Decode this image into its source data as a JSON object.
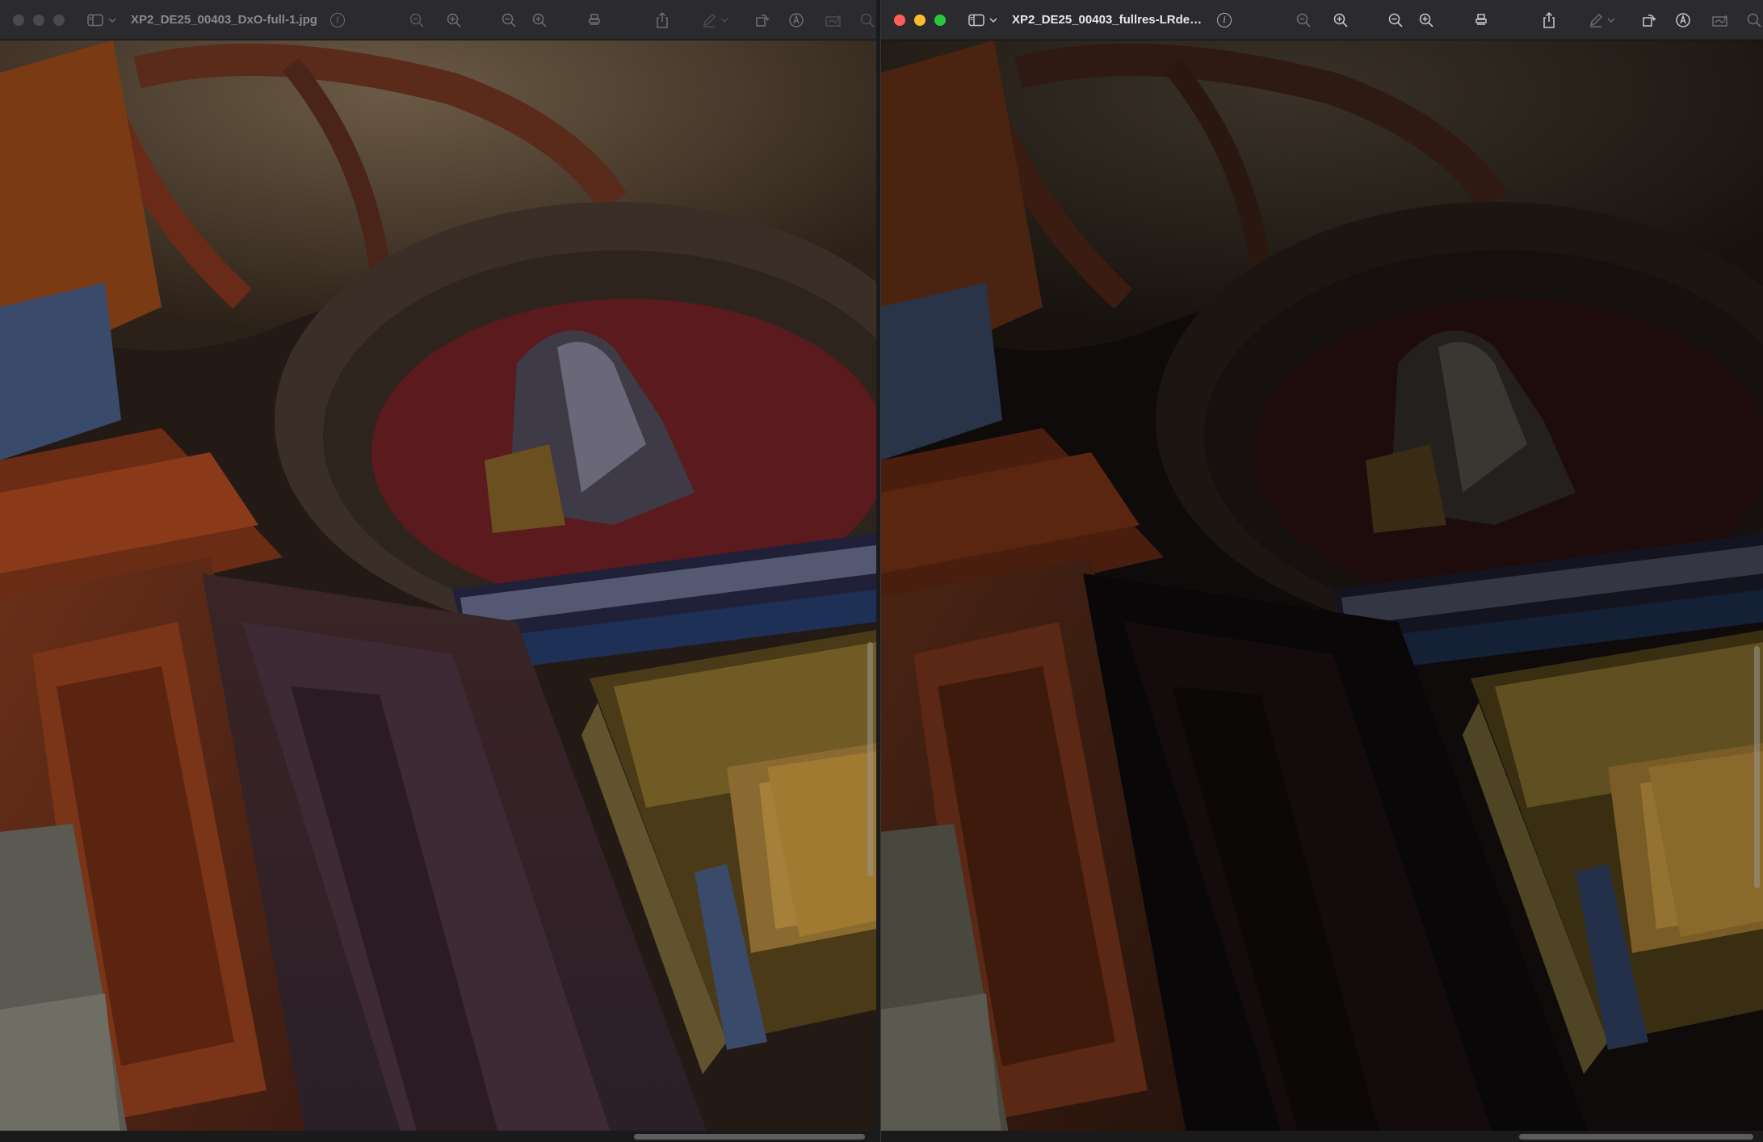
{
  "windows": [
    {
      "id": "left",
      "title": "XP2_DE25_00403_DxO-full-1.jpg",
      "active": false
    },
    {
      "id": "right",
      "title": "XP2_DE25_00403_fullres-LRden...",
      "active": true
    }
  ],
  "toolbar_icons": [
    "zoom-out-icon",
    "zoom-in-icon",
    "zoom-out-icon",
    "zoom-in-icon",
    "stamp-icon",
    "share-icon",
    "markup-pen-icon",
    "chevron-down-icon",
    "rotate-icon",
    "markup-circle-icon",
    "signature-icon",
    "search-icon"
  ],
  "colors": {
    "close": "#ff5f57",
    "minimize": "#febc2e",
    "maximize": "#28c840"
  }
}
